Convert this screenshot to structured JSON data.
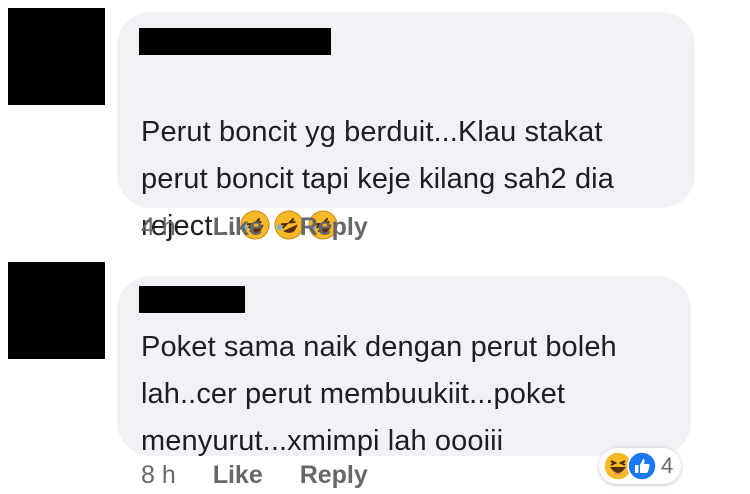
{
  "comments": [
    {
      "text": "Perut boncit yg berduit...Klau stakat\nperut boncit tapi keje kilang sah2 dia\nreject...",
      "emojis": [
        "rofl-icon",
        "rofl-icon",
        "rofl-icon"
      ],
      "time": "4 h",
      "like_label": "Like",
      "reply_label": "Reply"
    },
    {
      "text": "Poket sama naik dengan perut boleh\nlah..cer perut membuukiit...poket\nmenyurut...xmimpi lah oooiii",
      "time": "8 h",
      "like_label": "Like",
      "reply_label": "Reply",
      "reactions": {
        "icons": [
          "haha-icon",
          "like-icon"
        ],
        "count": "4"
      }
    }
  ],
  "colors": {
    "bubble": "#f0f2f5",
    "text": "#1c1e21",
    "meta": "#65676b",
    "like_blue": "#1877f2",
    "haha_yellow": "#f7b928"
  }
}
